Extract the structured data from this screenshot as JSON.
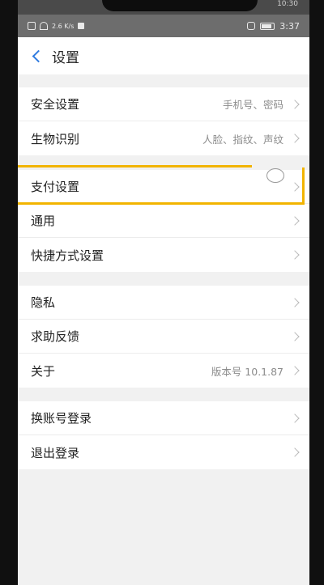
{
  "top_sliver_text": "10:30",
  "status_bar": {
    "left_text": "2.6 K/s",
    "right_battery": "97",
    "time": "3:37"
  },
  "header": {
    "back_icon": "chevron-left-icon",
    "title": "设置"
  },
  "groups": [
    {
      "items": [
        {
          "label": "安全设置",
          "value": "手机号、密码"
        },
        {
          "label": "生物识别",
          "value": "人脸、指纹、声纹"
        }
      ]
    },
    {
      "items": [
        {
          "label": "支付设置",
          "value": ""
        },
        {
          "label": "通用",
          "value": ""
        },
        {
          "label": "快捷方式设置",
          "value": ""
        }
      ]
    },
    {
      "items": [
        {
          "label": "隐私",
          "value": ""
        },
        {
          "label": "求助反馈",
          "value": ""
        },
        {
          "label": "关于",
          "value": "版本号 10.1.87"
        }
      ]
    },
    {
      "items": [
        {
          "label": "换账号登录",
          "value": ""
        },
        {
          "label": "退出登录",
          "value": ""
        }
      ]
    }
  ],
  "colors": {
    "accent": "#2f7be0",
    "highlight": "#f2b400",
    "background": "#f1f1f1"
  }
}
